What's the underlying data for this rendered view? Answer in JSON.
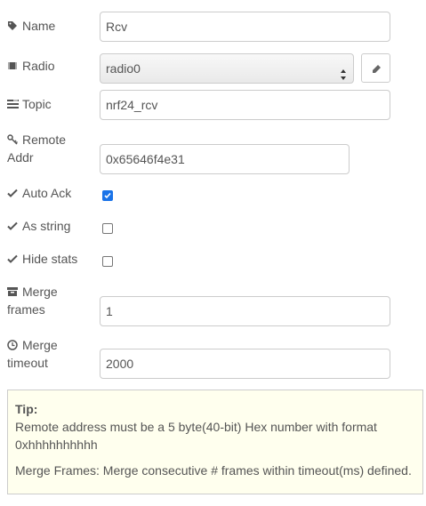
{
  "fields": {
    "name": {
      "label": "Name",
      "value": "Rcv"
    },
    "radio": {
      "label": "Radio",
      "selected": "radio0"
    },
    "topic": {
      "label": "Topic",
      "value": "nrf24_rcv"
    },
    "remote_addr": {
      "label_line1": "Remote",
      "label_line2": "Addr",
      "value": "0x65646f4e31"
    },
    "auto_ack": {
      "label": "Auto Ack",
      "checked": true
    },
    "as_string": {
      "label": "As string",
      "checked": false
    },
    "hide_stats": {
      "label": "Hide stats",
      "checked": false
    },
    "merge_frames": {
      "label_line1": "Merge",
      "label_line2": "frames",
      "value": "1"
    },
    "merge_timeout": {
      "label_line1": "Merge",
      "label_line2": "timeout",
      "value": "2000"
    }
  },
  "tip": {
    "title": "Tip:",
    "line1": "Remote address must be a 5 byte(40-bit) Hex number with format",
    "line2": "0xhhhhhhhhhh",
    "line3": "Merge Frames: Merge consecutive # frames within timeout(ms) defined."
  },
  "colors": {
    "checkbox_checked": "#1a73e8",
    "tip_background": "#ffffee",
    "border": "#cccccc"
  },
  "icons": {
    "name": "tag-icon",
    "radio": "chip-icon",
    "topic": "tasks-icon",
    "remote_addr": "key-icon",
    "checkmark": "check-icon",
    "merge_frames": "archive-icon",
    "merge_timeout": "clock-icon",
    "edit": "pencil-icon"
  }
}
